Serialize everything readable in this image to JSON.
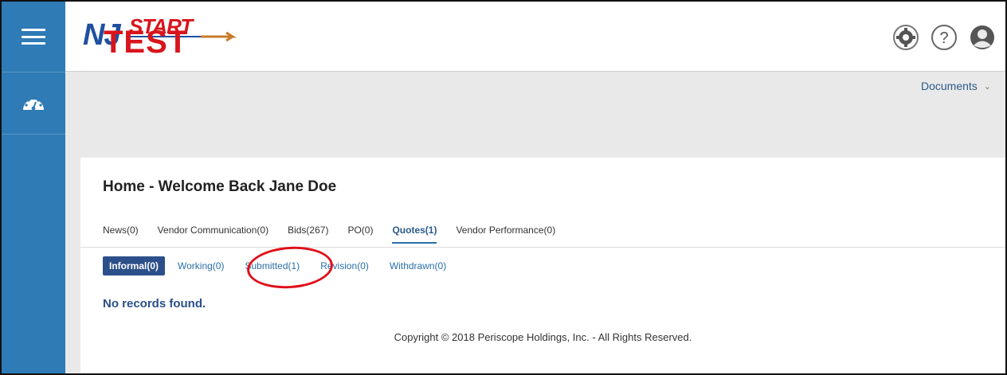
{
  "app": {
    "logo_text": "NJSTART",
    "test_overlay": "TEST"
  },
  "header": {
    "icons": [
      "gear-icon",
      "help-icon",
      "user-icon"
    ],
    "documents_label": "Documents"
  },
  "sidebar": {
    "icons": [
      "menu-icon",
      "dashboard-icon"
    ]
  },
  "main": {
    "title": "Home - Welcome Back Jane Doe",
    "tabs": [
      {
        "label": "News(0)"
      },
      {
        "label": "Vendor Communication(0)"
      },
      {
        "label": "Bids(267)"
      },
      {
        "label": "PO(0)"
      },
      {
        "label": "Quotes(1)"
      },
      {
        "label": "Vendor Performance(0)"
      }
    ],
    "subtabs": [
      {
        "label": "Informal(0)"
      },
      {
        "label": "Working(0)"
      },
      {
        "label": "Submitted(1)"
      },
      {
        "label": "Revision(0)"
      },
      {
        "label": "Withdrawn(0)"
      }
    ],
    "empty_message": "No records found.",
    "copyright": "Copyright © 2018 Periscope Holdings, Inc. - All Rights Reserved."
  },
  "colors": {
    "sidebar": "#2e7bb5",
    "accent": "#2b4f8a",
    "link": "#2a6fa8",
    "annotation": "#e0101a",
    "logo_red": "#d8141c",
    "logo_blue": "#1f4fa0"
  }
}
